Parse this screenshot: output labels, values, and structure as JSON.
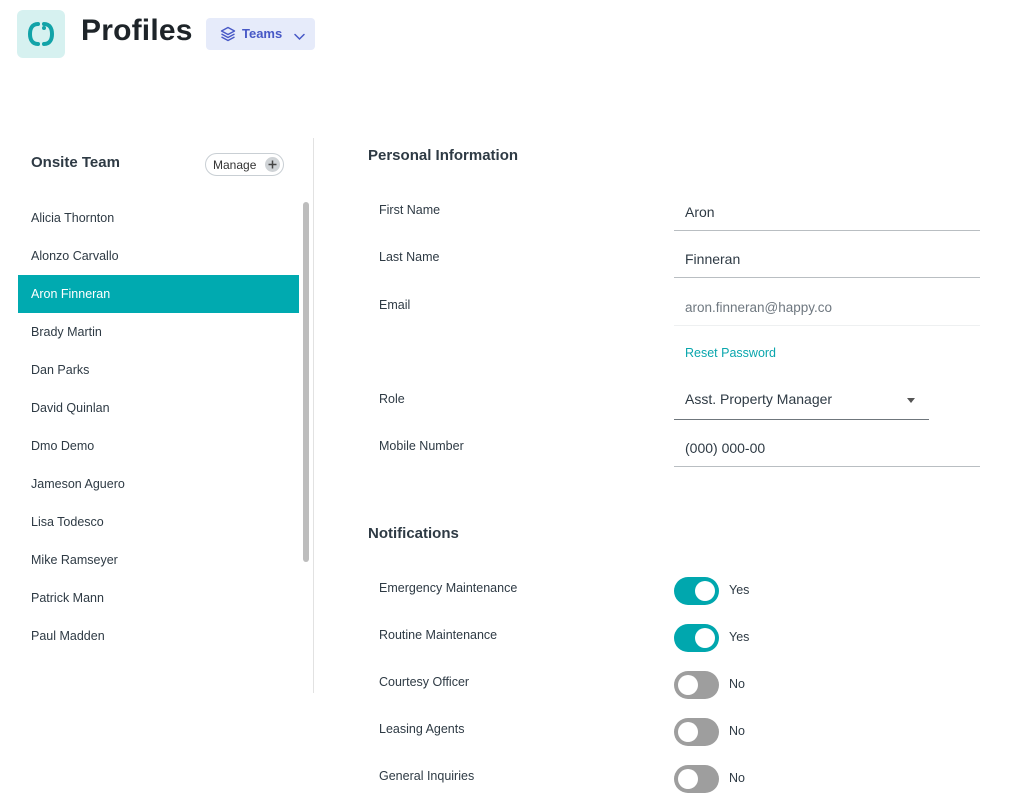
{
  "header": {
    "title": "Profiles",
    "teams_label": "Teams"
  },
  "sidebar": {
    "title": "Onsite Team",
    "manage_label": "Manage",
    "selected": "Aron Finneran",
    "items": [
      "Alicia Thornton",
      "Alonzo Carvallo",
      "Aron Finneran",
      "Brady Martin",
      "Dan Parks",
      "David Quinlan",
      "Dmo Demo",
      "Jameson Aguero",
      "Lisa Todesco",
      "Mike Ramseyer",
      "Patrick Mann",
      "Paul Madden"
    ]
  },
  "personal": {
    "title": "Personal Information",
    "first_name_label": "First Name",
    "first_name": "Aron",
    "last_name_label": "Last Name",
    "last_name": "Finneran",
    "email_label": "Email",
    "email": "aron.finneran@happy.co",
    "reset_password": "Reset Password",
    "role_label": "Role",
    "role": "Asst. Property Manager",
    "mobile_label": "Mobile Number",
    "mobile": "(000) 000-00"
  },
  "notifications": {
    "title": "Notifications",
    "items": [
      {
        "label": "Emergency Maintenance",
        "on": true,
        "state": "Yes"
      },
      {
        "label": "Routine Maintenance",
        "on": true,
        "state": "Yes"
      },
      {
        "label": "Courtesy Officer",
        "on": false,
        "state": "No"
      },
      {
        "label": "Leasing Agents",
        "on": false,
        "state": "No"
      },
      {
        "label": "General Inquiries",
        "on": false,
        "state": "No"
      }
    ]
  },
  "colors": {
    "accent": "#00aab0",
    "teams_bg": "#e6ebfa",
    "teams_text": "#4758c6",
    "toggle_off": "#9e9e9e"
  },
  "icons": {
    "logo": "app-logo-icon",
    "teams": "layers-icon",
    "teams_chevron": "chevron-down-icon",
    "manage": "plus-icon",
    "role_caret": "caret-down-icon"
  }
}
